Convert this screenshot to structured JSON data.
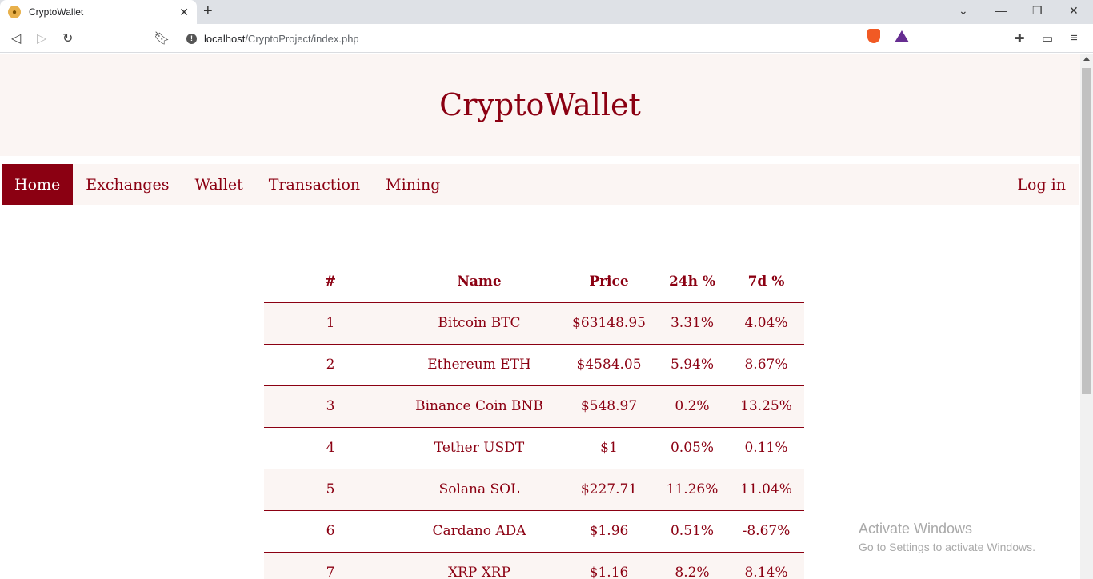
{
  "browser": {
    "tab_title": "CryptoWallet",
    "url_host": "localhost",
    "url_path": "/CryptoProject/index.php"
  },
  "site": {
    "title": "CryptoWallet"
  },
  "nav": {
    "items": [
      {
        "label": "Home",
        "active": true
      },
      {
        "label": "Exchanges",
        "active": false
      },
      {
        "label": "Wallet",
        "active": false
      },
      {
        "label": "Transaction",
        "active": false
      },
      {
        "label": "Mining",
        "active": false
      }
    ],
    "login": "Log in"
  },
  "table": {
    "headers": {
      "rank": "#",
      "name": "Name",
      "price": "Price",
      "change_24h": "24h %",
      "change_7d": "7d %"
    },
    "rows": [
      {
        "rank": "1",
        "name": "Bitcoin BTC",
        "price": "$63148.95",
        "change_24h": "3.31%",
        "change_7d": "4.04%"
      },
      {
        "rank": "2",
        "name": "Ethereum ETH",
        "price": "$4584.05",
        "change_24h": "5.94%",
        "change_7d": "8.67%"
      },
      {
        "rank": "3",
        "name": "Binance Coin BNB",
        "price": "$548.97",
        "change_24h": "0.2%",
        "change_7d": "13.25%"
      },
      {
        "rank": "4",
        "name": "Tether USDT",
        "price": "$1",
        "change_24h": "0.05%",
        "change_7d": "0.11%"
      },
      {
        "rank": "5",
        "name": "Solana SOL",
        "price": "$227.71",
        "change_24h": "11.26%",
        "change_7d": "11.04%"
      },
      {
        "rank": "6",
        "name": "Cardano ADA",
        "price": "$1.96",
        "change_24h": "0.51%",
        "change_7d": "-8.67%"
      },
      {
        "rank": "7",
        "name": "XRP XRP",
        "price": "$1.16",
        "change_24h": "8.2%",
        "change_7d": "8.14%"
      }
    ]
  },
  "watermark": {
    "line1": "Activate Windows",
    "line2": "Go to Settings to activate Windows."
  },
  "colors": {
    "accent": "#8b0012",
    "panel": "#fbf5f3"
  }
}
